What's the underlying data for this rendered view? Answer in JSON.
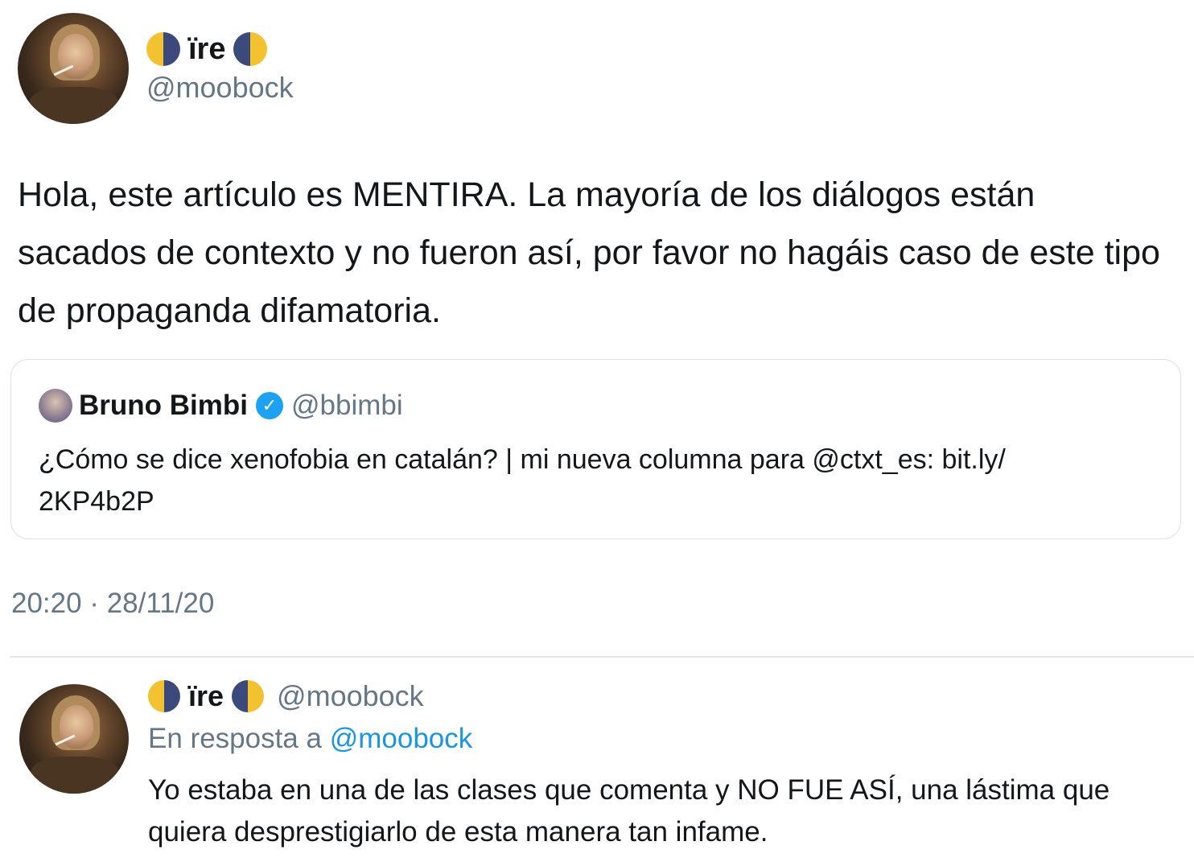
{
  "main_tweet": {
    "display_name": "ïre",
    "handle": "@moobock",
    "text": "Hola, este artículo es MENTIRA. La mayoría de los diálogos están sacados de contexto y no fueron así, por favor no hagáis caso de este tipo de propaganda difamatoria.",
    "timestamp": "20:20 · 28/11/20"
  },
  "quoted_tweet": {
    "display_name": "Bruno Bimbi",
    "handle": "@bbimbi",
    "text": "¿Cómo se dice xenofobia en catalán? | mi nueva columna para @ctxt_es: bit.ly/ 2KP4b2P"
  },
  "reply_tweet": {
    "display_name": "ïre",
    "handle": "@moobock",
    "reply_prefix": "En resposta a",
    "reply_to": "@moobock",
    "text": "Yo estaba en una de las clases que comenta y NO FUE ASÍ, una lástima que quiera desprestigiarlo de esta manera tan infame."
  },
  "icons": {
    "moon_left": "waxing-moon-icon",
    "moon_right": "waning-moon-icon",
    "verified": "verified-badge-icon"
  },
  "colors": {
    "link": "#1b95e0",
    "muted": "#657786",
    "text": "#14171a",
    "border": "#d9e0e6"
  }
}
